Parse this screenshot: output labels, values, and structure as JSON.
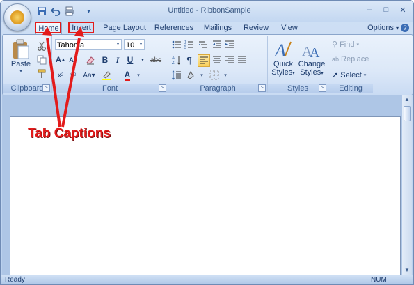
{
  "window": {
    "title": "Untitled - RibbonSample",
    "controls": {
      "minimize": "–",
      "maximize": "□",
      "close": "✕"
    }
  },
  "quick_access": {
    "icons": [
      "save-icon",
      "undo-icon",
      "print-icon",
      "customize-dropdown-icon"
    ]
  },
  "tabs": [
    {
      "label": "Home",
      "active": true
    },
    {
      "label": "Insert",
      "active": false
    },
    {
      "label": "Page Layout",
      "active": false
    },
    {
      "label": "References",
      "active": false
    },
    {
      "label": "Mailings",
      "active": false
    },
    {
      "label": "Review",
      "active": false
    },
    {
      "label": "View",
      "active": false
    }
  ],
  "options": {
    "label": "Options"
  },
  "ribbon": {
    "clipboard": {
      "label": "Clipboard",
      "paste_label": "Paste"
    },
    "font": {
      "label": "Font",
      "font_name": "Tahoma",
      "font_size": "10",
      "strikethrough_label": "abc"
    },
    "paragraph": {
      "label": "Paragraph"
    },
    "styles": {
      "label": "Styles",
      "quick_styles_line1": "Quick",
      "quick_styles_line2": "Styles",
      "change_styles_line1": "Change",
      "change_styles_line2": "Styles"
    },
    "editing": {
      "label": "Editing",
      "find_label": "Find",
      "replace_label": "Replace",
      "select_label": "Select"
    }
  },
  "annotation": {
    "text": "Tab Captions",
    "color": "#e31b1b"
  },
  "status": {
    "left": "Ready",
    "right": "NUM"
  }
}
